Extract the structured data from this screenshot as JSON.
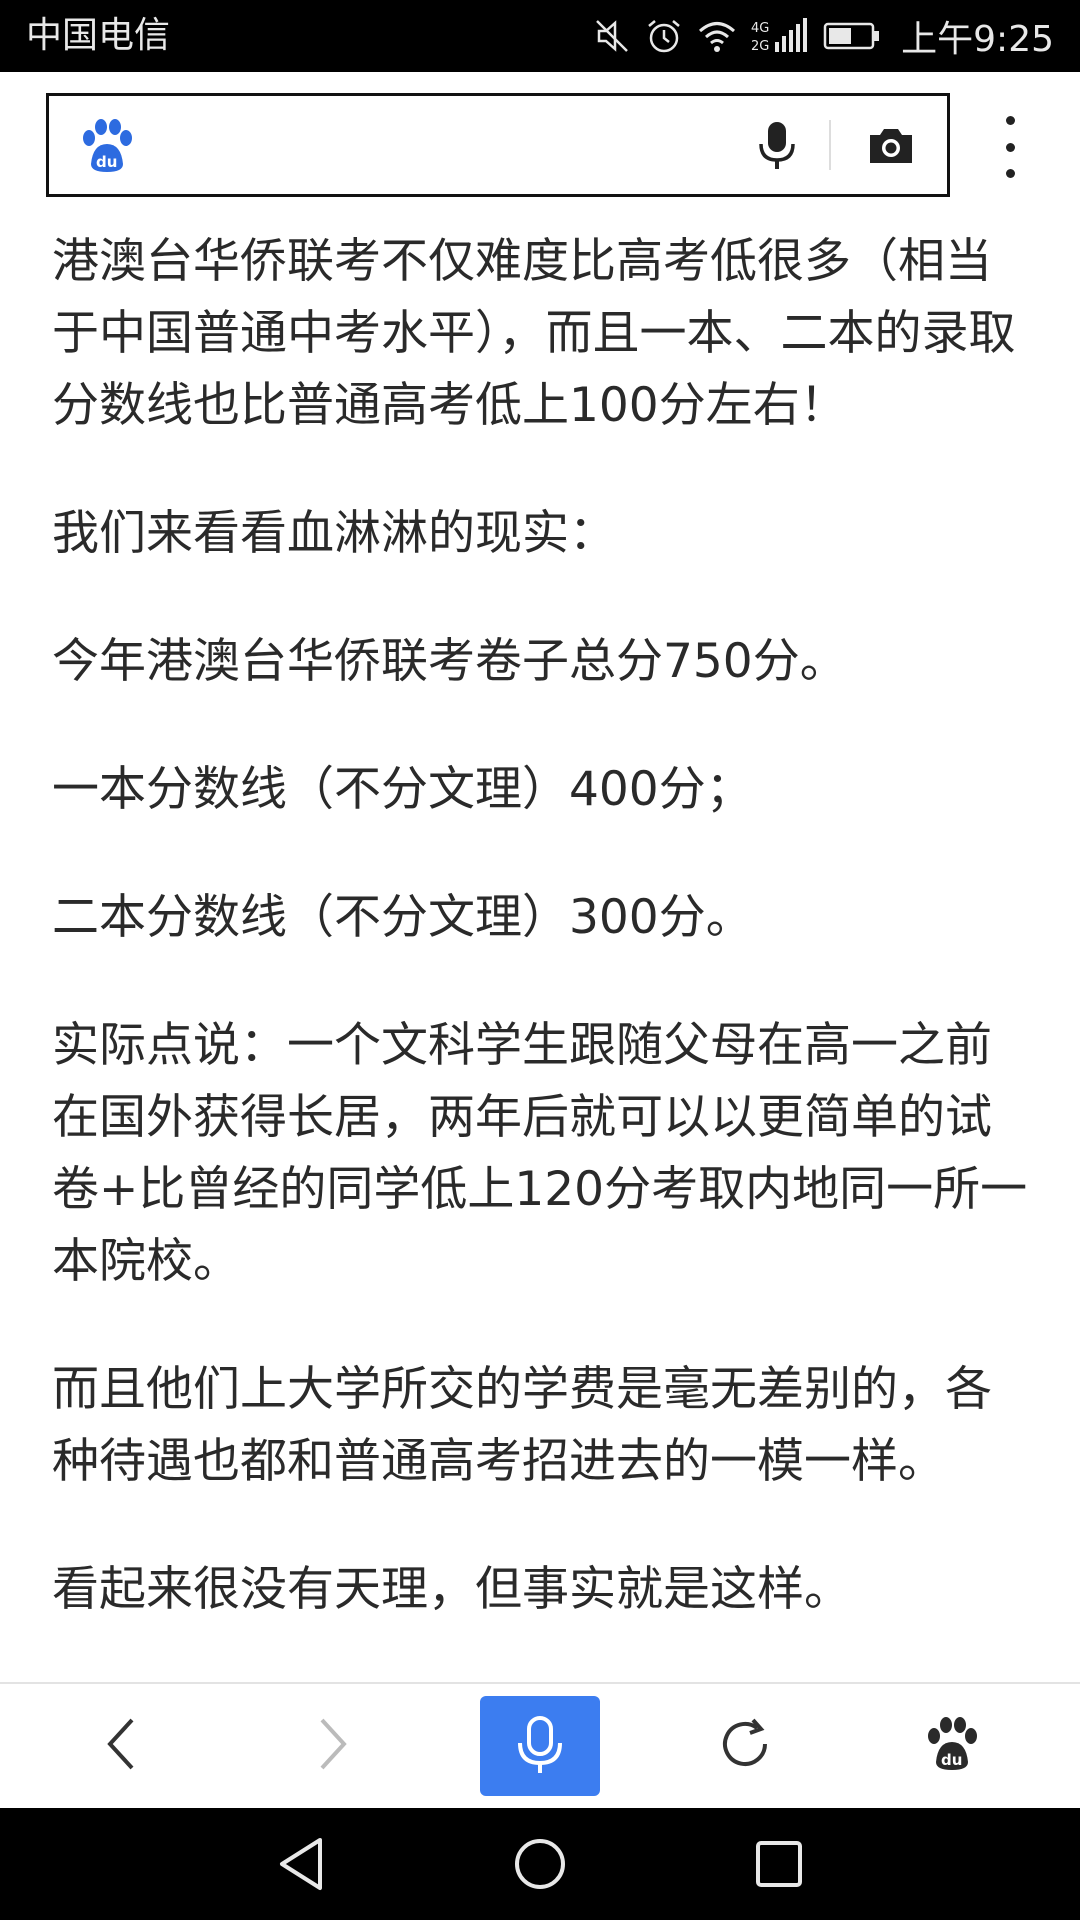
{
  "status_bar": {
    "carrier": "中国电信",
    "network": "4G 2G",
    "time": "上午9:25",
    "icons": [
      "mute-icon",
      "alarm-icon",
      "wifi-icon",
      "signal-icon",
      "battery-icon"
    ]
  },
  "search_bar": {
    "query": "",
    "logo": "baidu-paw-logo",
    "voice_icon": "microphone-icon",
    "camera_icon": "camera-icon",
    "menu_icon": "more-vertical-icon"
  },
  "article": {
    "paragraphs": [
      "港澳台华侨联考不仅难度比高考低很多（相当于中国普通中考水平），而且一本、二本的录取分数线也比普通高考低上100分左右！",
      "我们来看看血淋淋的现实：",
      "今年港澳台华侨联考卷子总分750分。",
      "一本分数线（不分文理）400分；",
      "二本分数线（不分文理）300分。",
      "实际点说：一个文科学生跟随父母在高一之前在国外获得长居，两年后就可以以更简单的试卷+比曾经的同学低上120分考取内地同一所一本院校。",
      "而且他们上大学所交的学费是毫无差别的，各种待遇也都和普通高考招进去的一模一样。",
      "看起来很没有天理，但事实就是这样。"
    ]
  },
  "toolbar": {
    "buttons": [
      "back-icon",
      "forward-icon",
      "microphone-icon",
      "refresh-icon",
      "baidu-paw-icon"
    ],
    "accent_color": "#3c7df0"
  },
  "nav_bar": {
    "buttons": [
      "back-triangle-icon",
      "home-circle-icon",
      "recents-square-icon"
    ]
  }
}
